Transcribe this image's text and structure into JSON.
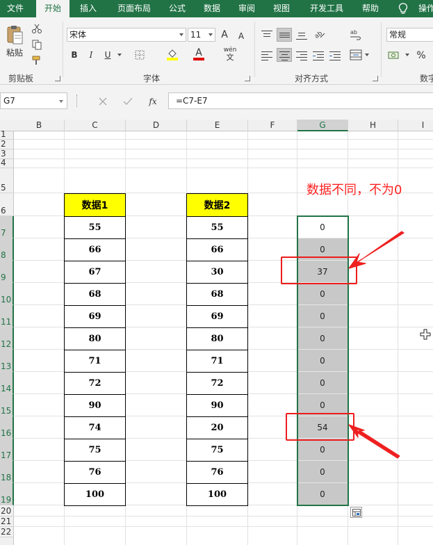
{
  "tabs": [
    "文件",
    "开始",
    "插入",
    "页面布局",
    "公式",
    "数据",
    "审阅",
    "视图",
    "开发工具",
    "帮助",
    "操作"
  ],
  "active_tab": "开始",
  "ribbon": {
    "clipboard": {
      "paste_label": "粘贴",
      "group_label": "剪贴板"
    },
    "font": {
      "name": "宋体",
      "size": "11",
      "grow": "A",
      "shrink": "A",
      "bold": "B",
      "italic": "I",
      "underline": "U",
      "font_color_glyph": "A",
      "phonetic_glyph": "wén",
      "group_label": "字体"
    },
    "alignment": {
      "group_label": "对齐方式"
    },
    "number": {
      "format": "常规",
      "percent": "%",
      "group_label": "数字"
    }
  },
  "formula_bar": {
    "name_box": "G7",
    "fx": "fx",
    "formula": "=C7-E7"
  },
  "columns": [
    "B",
    "C",
    "D",
    "E",
    "F",
    "G",
    "H",
    "I"
  ],
  "selected_column": "G",
  "rows": [
    "1",
    "2",
    "3",
    "4",
    "5",
    "6",
    "7",
    "8",
    "9",
    "10",
    "11",
    "12",
    "13",
    "14",
    "15",
    "16",
    "17",
    "18",
    "19",
    "20",
    "21",
    "22"
  ],
  "table1": {
    "header": "数据1",
    "values": [
      "55",
      "66",
      "67",
      "68",
      "69",
      "80",
      "71",
      "72",
      "90",
      "74",
      "75",
      "76",
      "100"
    ]
  },
  "table2": {
    "header": "数据2",
    "values": [
      "55",
      "66",
      "30",
      "68",
      "69",
      "80",
      "71",
      "72",
      "90",
      "20",
      "75",
      "76",
      "100"
    ]
  },
  "result_values": [
    "0",
    "0",
    "37",
    "0",
    "0",
    "0",
    "0",
    "0",
    "0",
    "54",
    "0",
    "0",
    "0"
  ],
  "annotation": "数据不同，不为0",
  "colors": {
    "excel_green": "#217346",
    "header_yellow": "#ffff00",
    "annotation_red": "#ff2222"
  }
}
